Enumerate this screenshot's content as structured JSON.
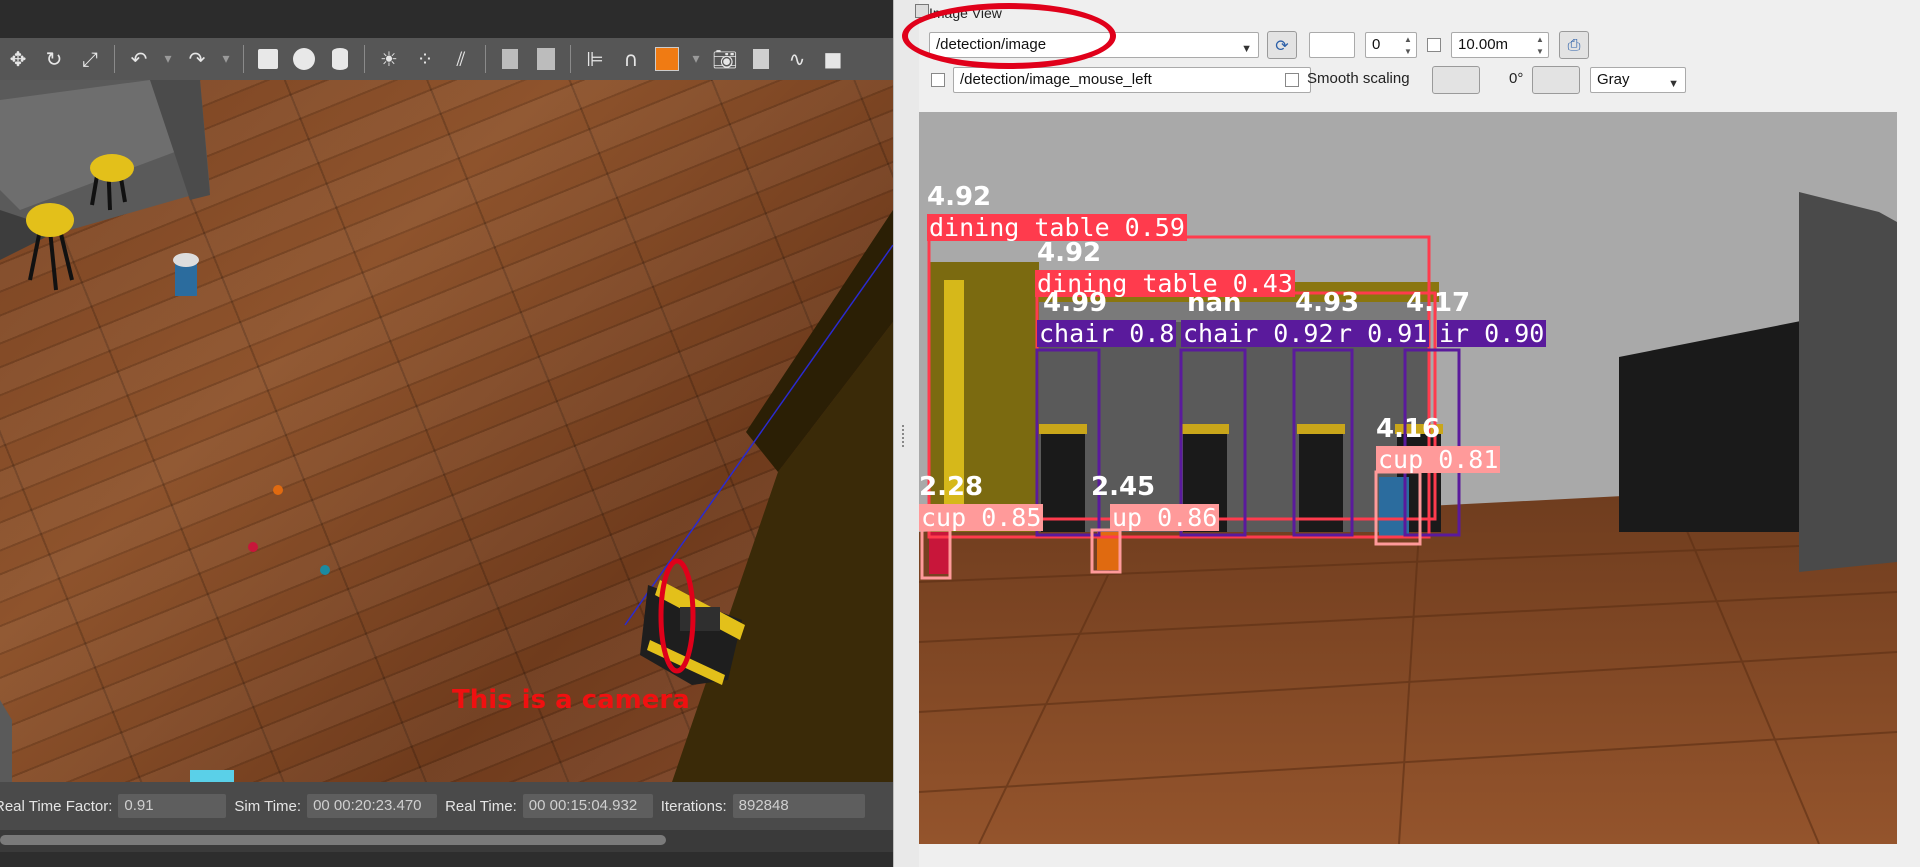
{
  "gazebo": {
    "toolbar_icons": [
      "translate-icon",
      "rotate-icon",
      "scale-icon",
      "undo-icon",
      "undo-history-icon",
      "redo-icon",
      "redo-history-icon",
      "box-icon",
      "sphere-icon",
      "cylinder-icon",
      "point-light-icon",
      "spot-light-icon",
      "directional-light-icon",
      "copy-icon",
      "paste-icon",
      "align-icon",
      "snap-icon",
      "change-view-icon",
      "screenshot-icon",
      "log-icon",
      "plot-icon",
      "record-video-icon"
    ],
    "annotation": "This is a camera",
    "status": {
      "real_time_factor_label": "Real Time Factor:",
      "real_time_factor": "0.91",
      "sim_time_label": "Sim Time:",
      "sim_time": "00 00:20:23.470",
      "real_time_label": "Real Time:",
      "real_time": "00 00:15:04.932",
      "iterations_label": "Iterations:",
      "iterations": "892848"
    }
  },
  "rqt": {
    "title": "Image View",
    "topic": "/detection/image",
    "value_field": "0",
    "max_range": "10.00m",
    "mouse_topic": "/detection/image_mouse_left",
    "smooth_scaling_label": "Smooth scaling",
    "rotation": "0°",
    "color_scheme": "Gray"
  },
  "detections": [
    {
      "label": "dining table 0.59",
      "distance": "4.92"
    },
    {
      "label": "dining table 0.43",
      "distance": "4.92"
    },
    {
      "label": "chair 0.8",
      "distance": "4.99"
    },
    {
      "label": "chair 0.92",
      "distance": "nan"
    },
    {
      "label": "r 0.91",
      "distance": "4.93"
    },
    {
      "label": "ir 0.90",
      "distance": "4.17"
    },
    {
      "label": "cup 0.81",
      "distance": "4.16"
    },
    {
      "label": "cup 0.85",
      "distance": "2.28"
    },
    {
      "label": "up 0.86",
      "distance": "2.45"
    }
  ],
  "colors": {
    "table_box": "#ff3b4d",
    "chair_box": "#5a1a9c",
    "cup_box": "#ff9a9a",
    "annotation_red": "#e0001a"
  }
}
